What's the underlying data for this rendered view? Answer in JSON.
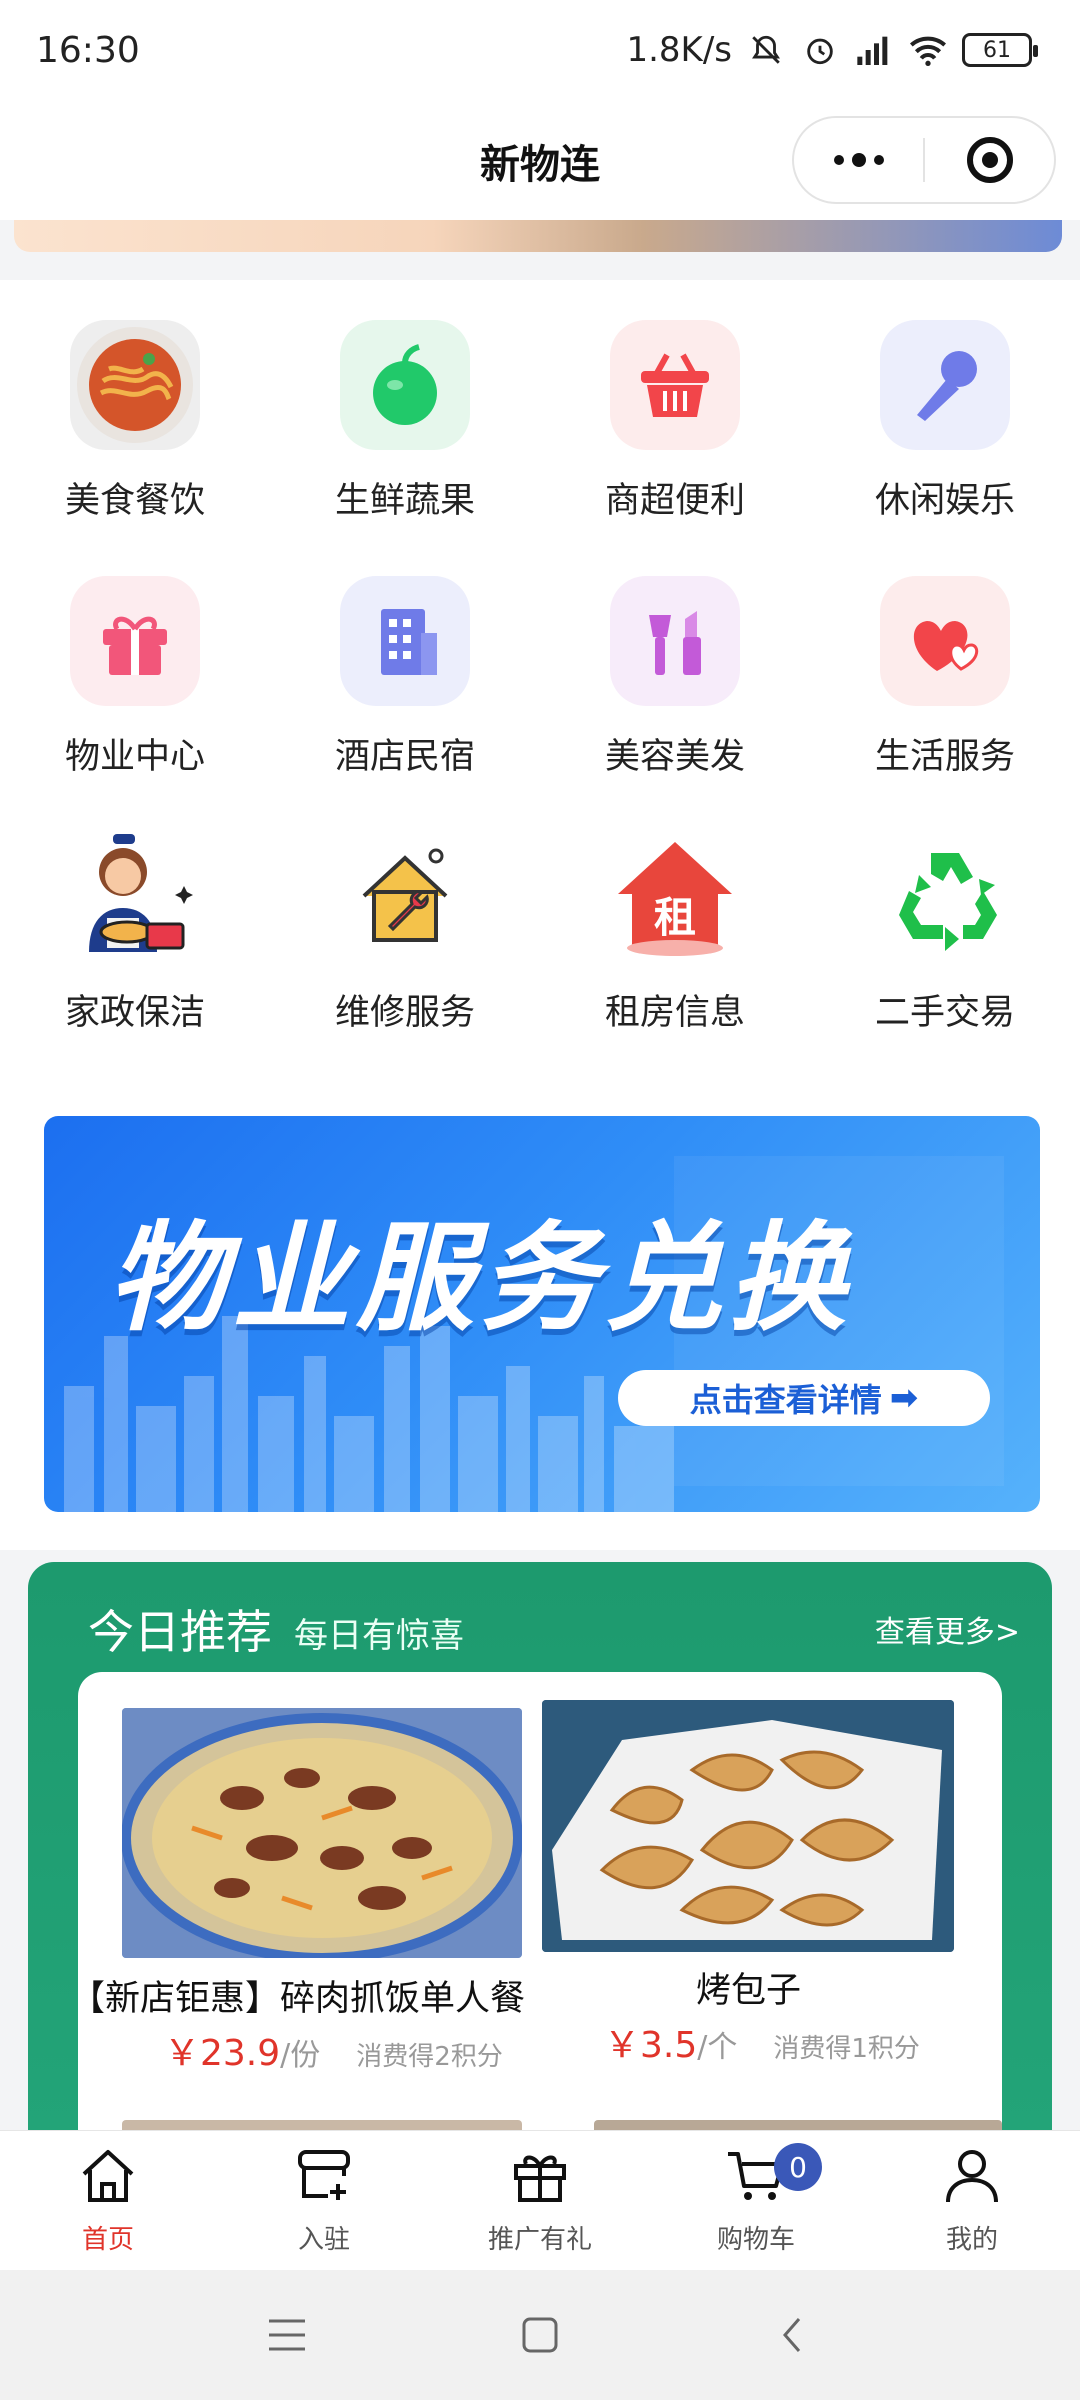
{
  "status_bar": {
    "time": "16:30",
    "speed": "1.8K/s",
    "battery": "61"
  },
  "title_bar": {
    "title": "新物连"
  },
  "categories": [
    {
      "label": "美食餐饮",
      "icon": "food-plate-icon"
    },
    {
      "label": "生鲜蔬果",
      "icon": "apple-icon"
    },
    {
      "label": "商超便利",
      "icon": "shopping-basket-icon"
    },
    {
      "label": "休闲娱乐",
      "icon": "microphone-icon"
    },
    {
      "label": "物业中心",
      "icon": "gift-box-icon"
    },
    {
      "label": "酒店民宿",
      "icon": "building-icon"
    },
    {
      "label": "美容美发",
      "icon": "cosmetics-icon"
    },
    {
      "label": "生活服务",
      "icon": "hearts-icon"
    },
    {
      "label": "家政保洁",
      "icon": "housekeeper-icon"
    },
    {
      "label": "维修服务",
      "icon": "house-wrench-icon"
    },
    {
      "label": "租房信息",
      "icon": "rent-house-icon"
    },
    {
      "label": "二手交易",
      "icon": "recycle-icon"
    }
  ],
  "promo": {
    "title": "物业服务兑换",
    "button": "点击查看详情",
    "arrow": "➡"
  },
  "recommend": {
    "title": "今日推荐",
    "subtitle": "每日有惊喜",
    "more": "查看更多>",
    "products": [
      {
        "name": "【新店钜惠】碎肉抓饭单人餐",
        "price": "￥23.9",
        "unit": "/份",
        "points": "消费得2积分"
      },
      {
        "name": "烤包子",
        "price": "￥3.5",
        "unit": "/个",
        "points": "消费得1积分"
      }
    ]
  },
  "tabs": [
    {
      "label": "首页",
      "icon": "home-icon",
      "active": true
    },
    {
      "label": "入驻",
      "icon": "store-add-icon"
    },
    {
      "label": "推广有礼",
      "icon": "gift-icon"
    },
    {
      "label": "购物车",
      "icon": "cart-icon",
      "badge": "0"
    },
    {
      "label": "我的",
      "icon": "user-icon"
    }
  ],
  "colors": {
    "accent_red": "#e0342a",
    "green_panel": "#1d9a6e",
    "promo_blue": "#1c6ff0",
    "badge_blue": "#3a58b8"
  }
}
